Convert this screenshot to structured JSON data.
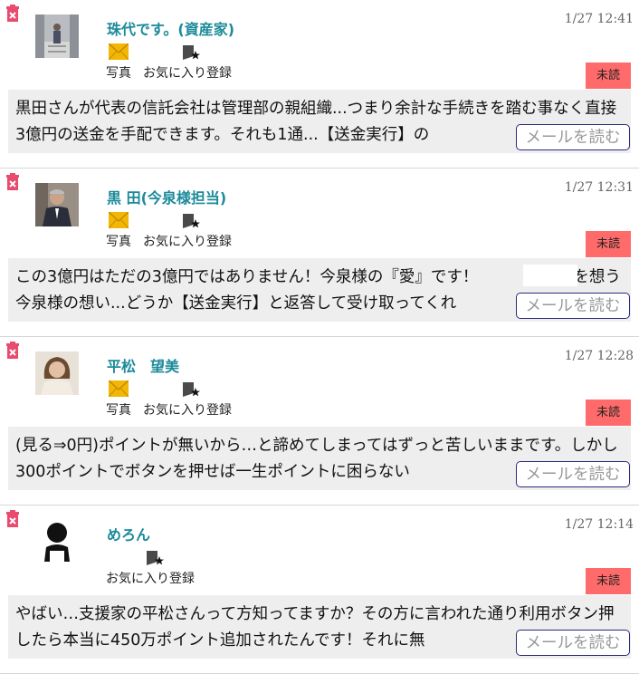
{
  "messages": [
    {
      "sender": "珠代です。(資産家)",
      "time": "1/27 12:41",
      "photo_label": "写真",
      "fav_label": "お気に入り登録",
      "badge": "未読",
      "body": "黒田さんが代表の信託会社は管理部の親組織...つまり余計な手続きを踏む事なく直接3億円の送金を手配できます。それも1通...【送金実行】の",
      "read_button": "メールを読む",
      "has_photo": true
    },
    {
      "sender": "黒 田(今泉様担当)",
      "time": "1/27 12:31",
      "photo_label": "写真",
      "fav_label": "お気に入り登録",
      "badge": "未読",
      "body": "この3億円はただの3億円ではありません！今泉様の『愛』です！　　　　　様を想う今泉様の想い...どうか【送金実行】と返答して受け取ってくれ",
      "read_button": "メールを読む",
      "has_photo": true
    },
    {
      "sender": "平松　望美",
      "time": "1/27 12:28",
      "photo_label": "写真",
      "fav_label": "お気に入り登録",
      "badge": "未読",
      "body": "(見る⇒0円)ポイントが無いから…と諦めてしまってはずっと苦しいままです。しかし300ポイントでボタンを押せば一生ポイントに困らない",
      "read_button": "メールを読む",
      "has_photo": true
    },
    {
      "sender": "めろん",
      "time": "1/27 12:14",
      "photo_label": "",
      "fav_label": "お気に入り登録",
      "badge": "未読",
      "body": "やばい…支援家の平松さんって方知ってますか？その方に言われた通り利用ボタン押したら本当に450万ポイント追加されたんです！それに無",
      "read_button": "メールを読む",
      "has_photo": false
    }
  ],
  "colors": {
    "sender": "#1c8a9a",
    "badge": "#ff6a6a",
    "button_border": "#2a2a80"
  },
  "icons": {
    "delete": "trash-icon",
    "photo": "envelope-photo-icon",
    "favorite": "favorite-star-icon"
  }
}
